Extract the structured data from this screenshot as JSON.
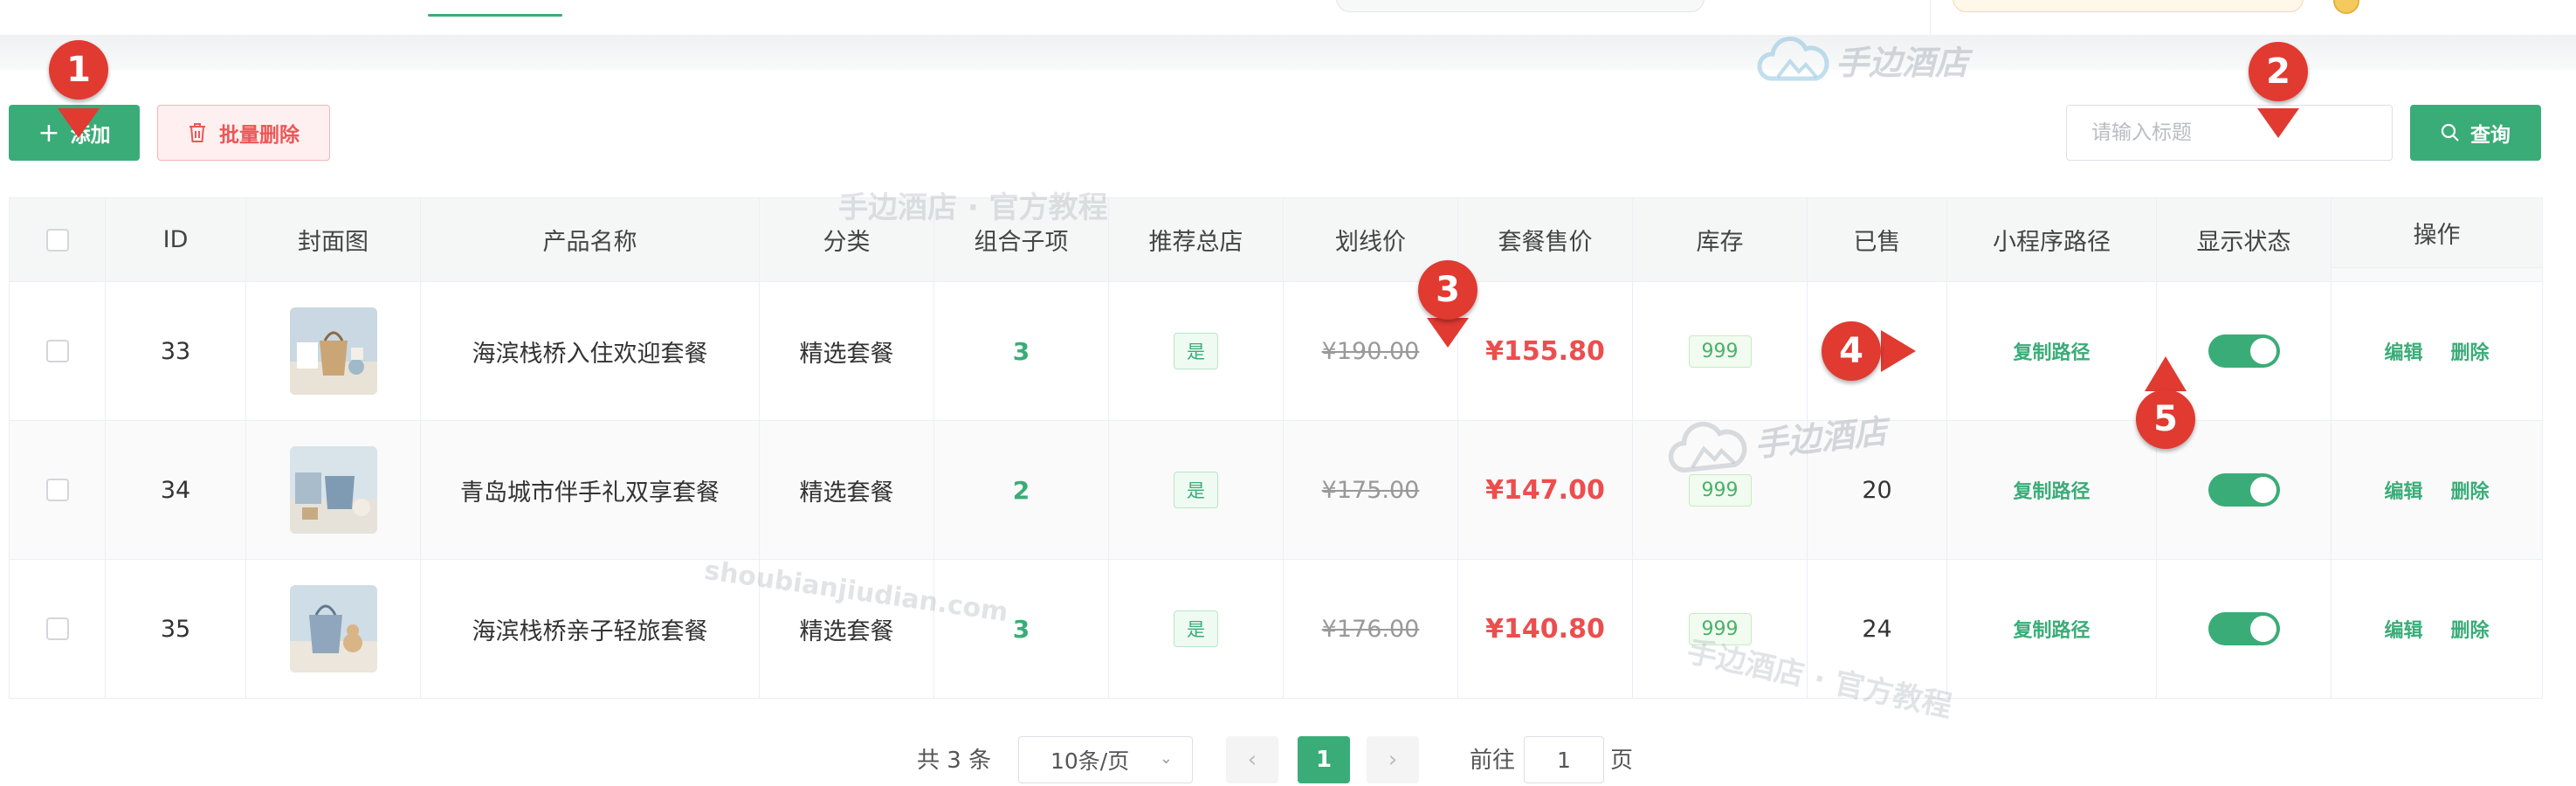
{
  "toolbar": {
    "add_label": "添加",
    "batch_delete_label": "批量删除",
    "search_placeholder": "请输入标题",
    "query_label": "查询"
  },
  "table": {
    "headers": [
      "ID",
      "封面图",
      "产品名称",
      "分类",
      "组合子项",
      "推荐总店",
      "划线价",
      "套餐售价",
      "库存",
      "已售",
      "小程序路径",
      "显示状态",
      "操作"
    ],
    "rows": [
      {
        "id": "33",
        "name": "海滨栈桥入住欢迎套餐",
        "category": "精选套餐",
        "sub_items": "3",
        "recommend": "是",
        "list_price": "¥190.00",
        "sale_price": "¥155.80",
        "stock": "999",
        "sold": "",
        "path_label": "复制路径",
        "status_on": true
      },
      {
        "id": "34",
        "name": "青岛城市伴手礼双享套餐",
        "category": "精选套餐",
        "sub_items": "2",
        "recommend": "是",
        "list_price": "¥175.00",
        "sale_price": "¥147.00",
        "stock": "999",
        "sold": "20",
        "path_label": "复制路径",
        "status_on": true
      },
      {
        "id": "35",
        "name": "海滨栈桥亲子轻旅套餐",
        "category": "精选套餐",
        "sub_items": "3",
        "recommend": "是",
        "list_price": "¥176.00",
        "sale_price": "¥140.80",
        "stock": "999",
        "sold": "24",
        "path_label": "复制路径",
        "status_on": true
      }
    ],
    "actions": {
      "edit": "编辑",
      "delete": "删除"
    }
  },
  "pagination": {
    "total": "共 3 条",
    "page_size": "10条/页",
    "prev": "‹",
    "current": "1",
    "next": "›",
    "goto_prefix": "前往",
    "goto_value": "1",
    "goto_suffix": "页"
  },
  "markers": [
    "1",
    "2",
    "3",
    "4",
    "5"
  ],
  "watermarks": {
    "brand": "手边酒店",
    "tutorial": "手边酒店 · 官方教程",
    "domain": "shoubianjiudian.com"
  },
  "colors": {
    "accent": "#3aac78",
    "danger": "#ec4e4e",
    "marker": "#e03a31"
  }
}
